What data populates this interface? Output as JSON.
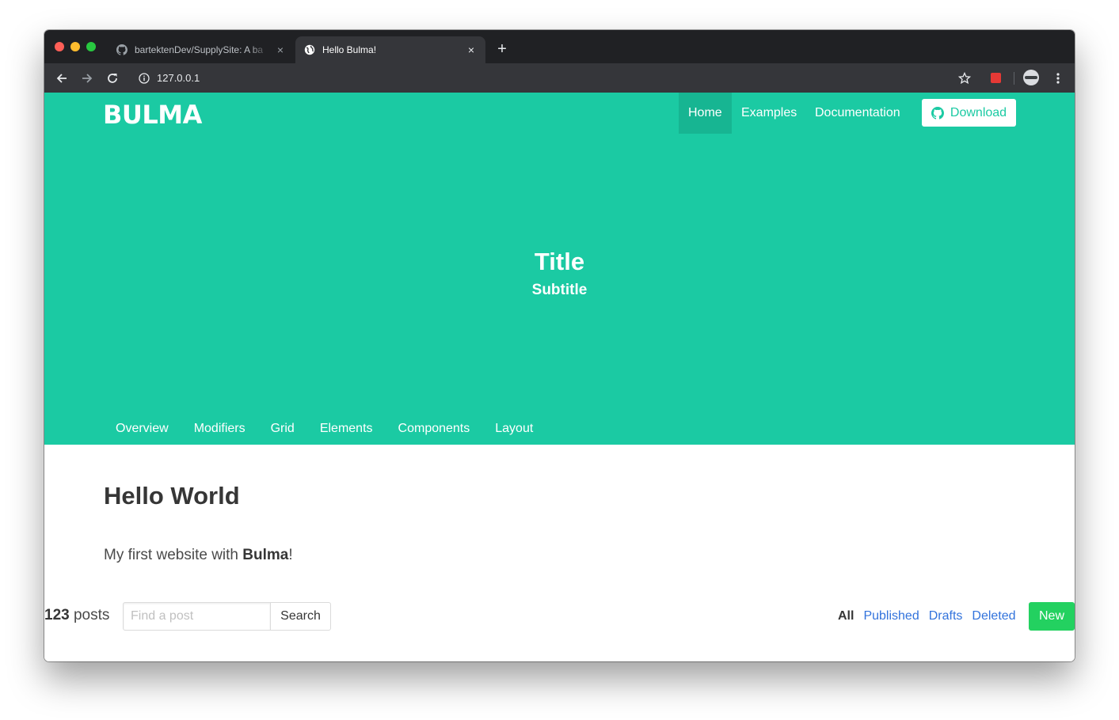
{
  "browser": {
    "tabs": [
      {
        "title": "bartektenDev/SupplySite: A ba",
        "close": "×",
        "favicon": "github-icon"
      },
      {
        "title": "Hello Bulma!",
        "close": "×",
        "favicon": "globe-icon"
      }
    ],
    "new_tab": "+",
    "address": "127.0.0.1",
    "icons": [
      "back-icon",
      "forward-icon",
      "reload-icon",
      "info-icon",
      "star-icon",
      "extension-icon",
      "profile-icon",
      "menu-icon"
    ]
  },
  "page": {
    "brand": "BULMA",
    "nav": {
      "home": "Home",
      "examples": "Examples",
      "documentation": "Documentation",
      "download": "Download"
    },
    "hero": {
      "title": "Title",
      "subtitle": "Subtitle",
      "tabs": [
        "Overview",
        "Modifiers",
        "Grid",
        "Elements",
        "Components",
        "Layout"
      ]
    },
    "content": {
      "heading": "Hello World",
      "subtitle_prefix": "My first website with ",
      "subtitle_bold": "Bulma",
      "subtitle_suffix": "!"
    },
    "level": {
      "count": "123",
      "count_label": " posts",
      "search_placeholder": "Find a post",
      "search_button": "Search",
      "filters": {
        "all": "All",
        "published": "Published",
        "drafts": "Drafts",
        "deleted": "Deleted"
      },
      "new_button": "New"
    }
  },
  "colors": {
    "primary": "#1bcaa3",
    "link": "#3273dc",
    "success": "#23d160",
    "text_strong": "#363636"
  }
}
